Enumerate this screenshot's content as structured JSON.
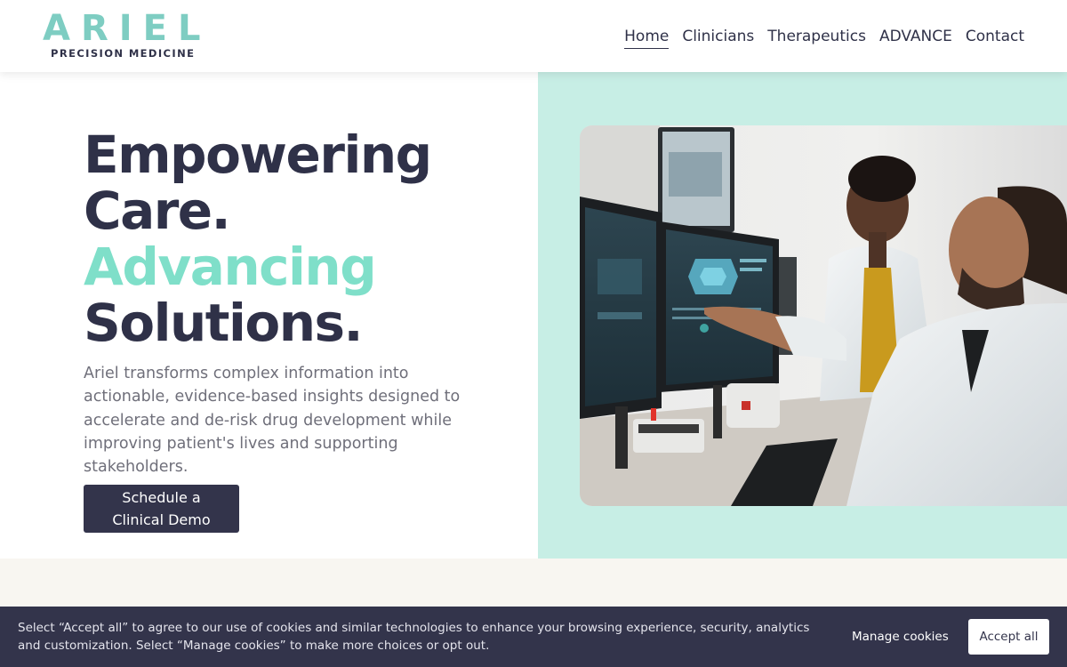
{
  "brand": {
    "name": "ARIEL",
    "tagline": "PRECISION MEDICINE",
    "colors": {
      "accent": "#7fdfc9",
      "navy": "#2f3148",
      "mint_bg": "#c7eee5",
      "banner_bg": "#33344b"
    }
  },
  "nav": {
    "items": [
      {
        "label": "Home",
        "active": true
      },
      {
        "label": "Clinicians",
        "active": false
      },
      {
        "label": "Therapeutics",
        "active": false
      },
      {
        "label": "ADVANCE",
        "active": false
      },
      {
        "label": "Contact",
        "active": false
      }
    ]
  },
  "hero": {
    "headline": {
      "line1": "Empowering",
      "line2": "Care.",
      "line3": "Advancing",
      "line4": "Solutions."
    },
    "description": "Ariel transforms complex information into actionable, evidence-based insights designed to accelerate and de-risk drug development while improving patient's lives and supporting stakeholders.",
    "cta_label": "Schedule a Clinical Demo",
    "image_icon": "photo-clinicians-at-monitors"
  },
  "cookie_banner": {
    "text": "Select “Accept all” to agree to our use of cookies and similar technologies to enhance your browsing experience, security, analytics and customization. Select “Manage cookies” to make more choices or opt out.",
    "manage_label": "Manage cookies",
    "accept_label": "Accept all"
  }
}
